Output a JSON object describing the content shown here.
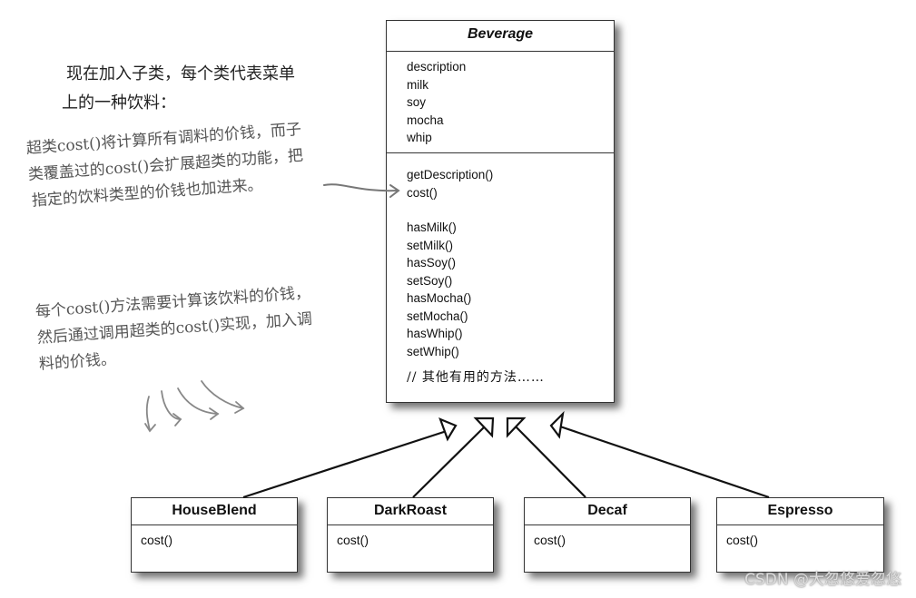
{
  "intro_text": {
    "lines": [
      "现在加入子类，每个类代表菜单",
      "上的一种饮料："
    ]
  },
  "notes": {
    "superclass_cost": {
      "lines": [
        "超类cost()将计算所有调料的价钱，而子",
        "类覆盖过的cost()会扩展超类的功能，把",
        "指定的饮料类型的价钱也加进来。"
      ]
    },
    "subclass_cost": {
      "lines": [
        "每个cost()方法需要计算该饮料的价钱，",
        "然后通过调用超类的cost()实现，加入调",
        "料的价钱。"
      ]
    }
  },
  "beverage_class": {
    "name": "Beverage",
    "attributes": [
      "description",
      "milk",
      "soy",
      "mocha",
      "whip"
    ],
    "methods_primary": [
      "getDescription()",
      "cost()"
    ],
    "methods_condiments": [
      "hasMilk()",
      "setMilk()",
      "hasSoy()",
      "setSoy()",
      "hasMocha()",
      "setMocha()",
      "hasWhip()",
      "setWhip()"
    ],
    "comment": "// 其他有用的方法……"
  },
  "subclasses": [
    {
      "name": "HouseBlend",
      "method": "cost()"
    },
    {
      "name": "DarkRoast",
      "method": "cost()"
    },
    {
      "name": "Decaf",
      "method": "cost()"
    },
    {
      "name": "Espresso",
      "method": "cost()"
    }
  ],
  "watermark": "CSDN @大忽悠爱忽悠",
  "colors": {
    "line": "#111111",
    "annotation": "#777777",
    "shadow": "#555555"
  }
}
